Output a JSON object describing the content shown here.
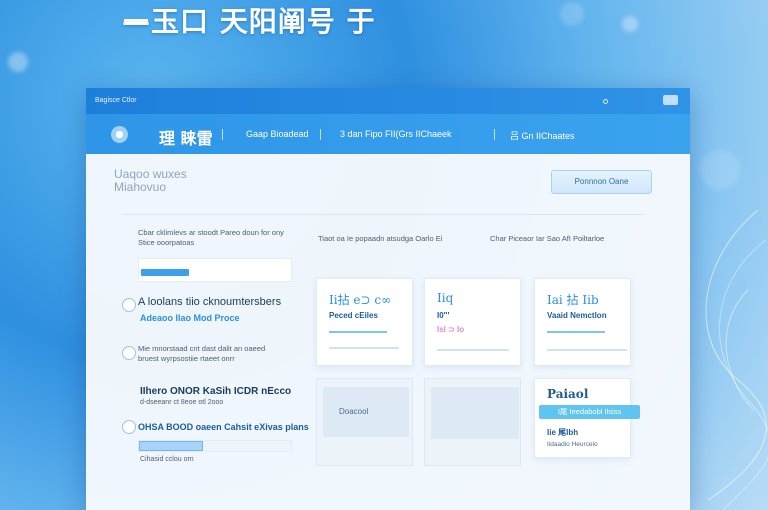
{
  "hero": {
    "title": "—玉口  天阳阐号 于"
  },
  "window": {
    "app_title": "Bagisce Ctlor",
    "nav": {
      "brand": "理 睐雷",
      "items": [
        {
          "label": "Gaap Bioadead"
        },
        {
          "label": "3 dan Fipo FII(Grs IIChaeek"
        },
        {
          "label": "吕 Gn IIChaates"
        }
      ]
    },
    "page_heading": [
      "Uaqoo wuxes",
      "Miahovuo"
    ],
    "action_button": "Ponnnon Oane",
    "left": {
      "intro": "Cbar cklimlevs ar stoodt Pareo doun for ony Stice ooorpatoas",
      "option1": {
        "title": "A loolans tiio cknoumtersbers",
        "sub": "Adeaoo Ilao Mod Proce"
      },
      "option2": {
        "desc": "Mie mnorstaad cnt dast dalit an oaeed bruest wyrpsostiie rtaeet onrr"
      },
      "bold1": "IIhero ONOR KaSih ICDR nEcco",
      "small1": "d-dseeanr ct 8eoe otl 2ooo",
      "option3": {
        "title": "OHSA BOOD oaeen Cahsit eXivas plans"
      },
      "progress_pct": 42,
      "small2": "Cihasid cclou orn"
    },
    "columns": [
      "Tiaot oa Ie popaadn atsudga Oarlo Ei",
      "Char Piceaor Iar Sao  AfI Poiltarloe"
    ],
    "cards": [
      {
        "title": "Ii拈 e⊃ c∞",
        "sub": "Peced cEiles"
      },
      {
        "title": "Iiq",
        "sub": "I0\"'",
        "sub2": "Isl ⊃ Io"
      },
      {
        "title": "Iai 拈 Iib",
        "sub": "Vaaid Nemctlon"
      }
    ],
    "ghost_label": "Doacool",
    "last_card": {
      "title": "Paiaol",
      "pill": "I尾 Ieedabobl Ilsiss",
      "sub": "Iie 尾Ibh",
      "small": "Iidaadio Heurcelo"
    }
  },
  "colors": {
    "accent": "#2f93e6",
    "highlight": "#5fc4ef"
  }
}
